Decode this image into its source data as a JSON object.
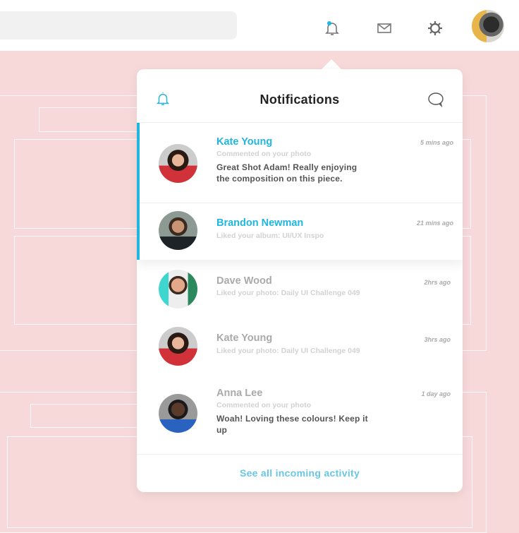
{
  "topbar": {
    "search_placeholder": "",
    "icons": [
      "bell-icon",
      "mail-icon",
      "gear-icon"
    ],
    "has_unread_dot": true
  },
  "panel": {
    "title": "Notifications",
    "footer_link": "See all incoming activity",
    "items": [
      {
        "name": "Kate Young",
        "action": "Commented on your photo",
        "message": "Great Shot Adam! Really enjoying the composition on this piece.",
        "time": "5 mins ago",
        "unread": true
      },
      {
        "name": "Brandon Newman",
        "action": "Liked your album: UI/UX Inspo",
        "time": "21 mins ago",
        "unread": true
      },
      {
        "name": "Dave Wood",
        "action": "Liked your photo: Daily UI Challenge 049",
        "time": "2hrs ago",
        "unread": false
      },
      {
        "name": "Kate Young",
        "action": "Liked your photo: Daily UI Challenge 049",
        "time": "3hrs ago",
        "unread": false
      },
      {
        "name": "Anna Lee",
        "action": "Commented on your photo",
        "message": "Woah! Loving these colours! Keep it up",
        "time": "1 day ago",
        "unread": false
      }
    ]
  },
  "colors": {
    "accent": "#1fb6df",
    "background": "#f7d9d9"
  }
}
